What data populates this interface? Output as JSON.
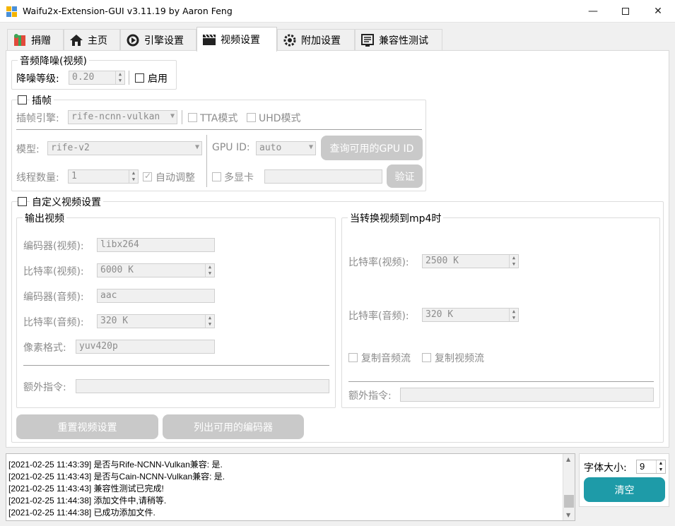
{
  "window": {
    "title": "Waifu2x-Extension-GUI v3.11.19 by Aaron Feng"
  },
  "tabs": [
    {
      "label": "捐赠"
    },
    {
      "label": "主页"
    },
    {
      "label": "引擎设置"
    },
    {
      "label": "视频设置"
    },
    {
      "label": "附加设置"
    },
    {
      "label": "兼容性测试"
    }
  ],
  "audio_denoise": {
    "title": "音频降噪(视频)",
    "level_label": "降噪等级:",
    "level_value": "0.20",
    "enable_label": "启用"
  },
  "interp": {
    "title": "插帧",
    "engine_label": "插帧引擎:",
    "engine_value": "rife-ncnn-vulkan",
    "tta_label": "TTA模式",
    "uhd_label": "UHD模式",
    "model_label": "模型:",
    "model_value": "rife-v2",
    "gpu_label": "GPU ID:",
    "gpu_value": "auto",
    "query_gpu_label": "查询可用的GPU ID",
    "threads_label": "线程数量:",
    "threads_value": "1",
    "auto_adjust_label": "自动调整",
    "multi_gpu_label": "多显卡",
    "verify_label": "验证"
  },
  "custom": {
    "title": "自定义视频设置",
    "output": {
      "title": "输出视频",
      "vcodec_label": "编码器(视频):",
      "vcodec_value": "libx264",
      "vbitrate_label": "比特率(视频):",
      "vbitrate_value": "6000 K",
      "acodec_label": "编码器(音频):",
      "acodec_value": "aac",
      "abitrate_label": "比特率(音频):",
      "abitrate_value": "320 K",
      "pixfmt_label": "像素格式:",
      "pixfmt_value": "yuv420p",
      "extra_label": "额外指令:"
    },
    "mp4": {
      "title": "当转换视频到mp4时",
      "vbitrate_label": "比特率(视频):",
      "vbitrate_value": "2500 K",
      "abitrate_label": "比特率(音频):",
      "abitrate_value": "320 K",
      "copy_audio_label": "复制音频流",
      "copy_video_label": "复制视频流",
      "extra_label": "额外指令:"
    },
    "reset_label": "重置视频设置",
    "list_encoders_label": "列出可用的编码器"
  },
  "log": [
    "[2021-02-25 11:43:39] 是否与Rife-NCNN-Vulkan兼容: 是.",
    "[2021-02-25 11:43:43] 是否与Cain-NCNN-Vulkan兼容: 是.",
    "[2021-02-25 11:43:43] 兼容性测试已完成!",
    "[2021-02-25 11:44:38] 添加文件中,请稍等.",
    "[2021-02-25 11:44:38] 已成功添加文件."
  ],
  "side": {
    "font_size_label": "字体大小:",
    "font_size_value": "9",
    "clear_label": "清空"
  },
  "colors": {
    "accent": "#1e9ba8",
    "disabled_button": "#c9c9c9"
  }
}
